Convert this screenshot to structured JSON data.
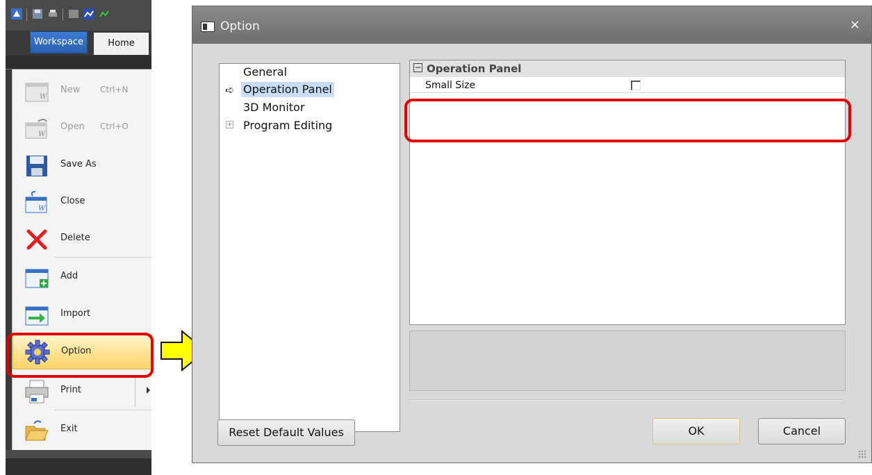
{
  "app": {
    "tabs": {
      "workspace": "Workspace",
      "home": "Home"
    },
    "menu": [
      {
        "label": "New",
        "shortcut": "Ctrl+N",
        "icon": "new-workspace-icon",
        "disabled": true
      },
      {
        "label": "Open",
        "shortcut": "Ctrl+O",
        "icon": "open-workspace-icon",
        "disabled": true
      },
      {
        "label": "Save As",
        "icon": "save-icon"
      },
      {
        "label": "Close",
        "icon": "close-workspace-icon"
      },
      {
        "label": "Delete",
        "icon": "delete-x-icon"
      },
      {
        "label": "Add",
        "icon": "add-icon"
      },
      {
        "label": "Import",
        "icon": "import-icon"
      },
      {
        "label": "Option",
        "icon": "gear-icon",
        "highlighted": true
      },
      {
        "label": "Print",
        "icon": "printer-icon",
        "has_submenu": true
      },
      {
        "label": "Exit",
        "icon": "folder-exit-icon"
      }
    ]
  },
  "dialog": {
    "title": "Option",
    "close_glyph": "×",
    "tree": {
      "items": [
        "General",
        "Operation Panel",
        "3D Monitor",
        "Program Editing"
      ],
      "selected": "Operation Panel",
      "expand_glyph": "+"
    },
    "property_grid": {
      "category": "Operation Panel",
      "collapse_glyph": "−",
      "properties": [
        {
          "name": "Small Size",
          "value": false
        }
      ]
    },
    "buttons": {
      "reset": "Reset Default Values",
      "ok": "OK",
      "cancel": "Cancel"
    }
  },
  "colors": {
    "highlight_outline": "#e00000",
    "arrow_fill": "#ffff00",
    "selected_tree_item": "#c9def5",
    "workspace_tab": "#3d7bd1"
  }
}
